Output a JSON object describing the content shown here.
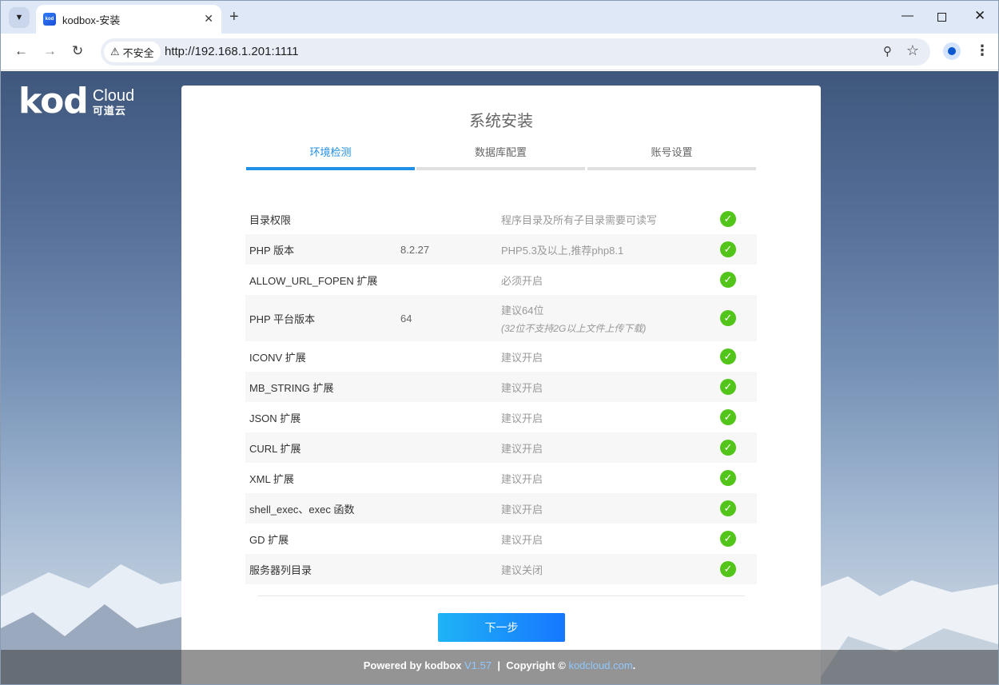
{
  "browser": {
    "tab_title": "kodbox-安装",
    "favicon_text": "kod",
    "security_label": "不安全",
    "url": "http://192.168.1.201:1111"
  },
  "logo": {
    "main": "kod",
    "cloud": "Cloud",
    "cn": "可道云"
  },
  "install": {
    "title": "系统安装",
    "steps": [
      {
        "label": "环境检测",
        "active": true
      },
      {
        "label": "数据库配置",
        "active": false
      },
      {
        "label": "账号设置",
        "active": false
      }
    ],
    "checks": [
      {
        "name": "目录权限",
        "value": "",
        "desc": "程序目录及所有子目录需要可读写",
        "sub": "",
        "status": "ok"
      },
      {
        "name": "PHP 版本",
        "value": "8.2.27",
        "desc": "PHP5.3及以上,推荐php8.1",
        "sub": "",
        "status": "ok"
      },
      {
        "name": "ALLOW_URL_FOPEN 扩展",
        "value": "",
        "desc": "必须开启",
        "sub": "",
        "status": "ok"
      },
      {
        "name": "PHP 平台版本",
        "value": "64",
        "desc": "建议64位",
        "sub": "(32位不支持2G以上文件上传下载)",
        "status": "ok"
      },
      {
        "name": "ICONV 扩展",
        "value": "",
        "desc": "建议开启",
        "sub": "",
        "status": "ok"
      },
      {
        "name": "MB_STRING 扩展",
        "value": "",
        "desc": "建议开启",
        "sub": "",
        "status": "ok"
      },
      {
        "name": "JSON 扩展",
        "value": "",
        "desc": "建议开启",
        "sub": "",
        "status": "ok"
      },
      {
        "name": "CURL 扩展",
        "value": "",
        "desc": "建议开启",
        "sub": "",
        "status": "ok"
      },
      {
        "name": "XML 扩展",
        "value": "",
        "desc": "建议开启",
        "sub": "",
        "status": "ok"
      },
      {
        "name": "shell_exec、exec 函数",
        "value": "",
        "desc": "建议开启",
        "sub": "",
        "status": "ok"
      },
      {
        "name": "GD 扩展",
        "value": "",
        "desc": "建议开启",
        "sub": "",
        "status": "ok"
      },
      {
        "name": "服务器列目录",
        "value": "",
        "desc": "建议关闭",
        "sub": "",
        "status": "ok"
      }
    ],
    "next_label": "下一步"
  },
  "footer": {
    "powered": "Powered by kodbox",
    "version": "V1.57",
    "sep": "|",
    "copyright": "Copyright ©",
    "link": "kodcloud.com",
    "end": "."
  },
  "colors": {
    "accent": "#1f8fe8",
    "ok": "#52c41a",
    "button_start": "#1fb3f5",
    "button_end": "#1677ff"
  }
}
